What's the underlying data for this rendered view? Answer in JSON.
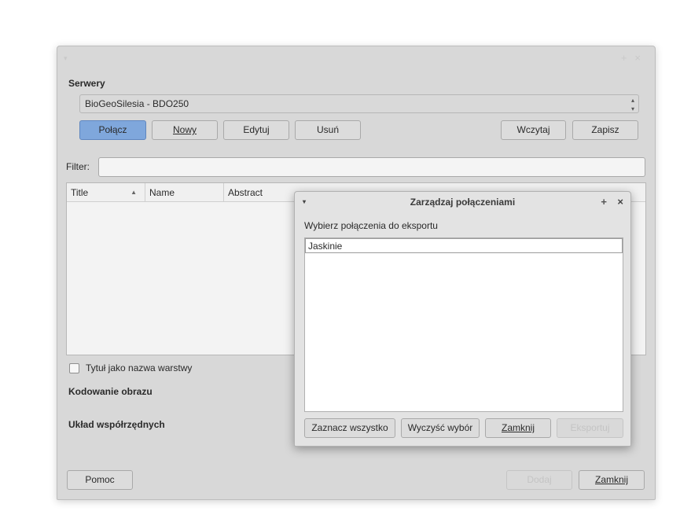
{
  "main": {
    "servers_label": "Serwery",
    "server_selected": "BioGeoSilesia - BDO250",
    "buttons": {
      "connect": "Połącz",
      "new": "Nowy",
      "edit": "Edytuj",
      "delete": "Usuń",
      "load": "Wczytaj",
      "save": "Zapisz"
    },
    "filter_label": "Filter:",
    "filter_value": "",
    "table_headers": [
      "Title",
      "Name",
      "Abstract"
    ],
    "title_as_layer_name": "Tytuł jako nazwa warstwy",
    "image_encoding_label": "Kodowanie obrazu",
    "crs_label": "Układ współrzędnych",
    "help_button": "Pomoc",
    "add_button": "Dodaj",
    "close_button": "Zamknij"
  },
  "manage": {
    "title": "Zarządzaj połączeniami",
    "select_label": "Wybierz połączenia do eksportu",
    "items": [
      "Jaskinie"
    ],
    "buttons": {
      "select_all": "Zaznacz wszystko",
      "clear_selection": "Wyczyść wybór",
      "close": "Zamknij",
      "export": "Eksportuj"
    }
  },
  "colors": {
    "primary_button": "#7fa7dc",
    "dialog_bg": "#d8d8d8"
  }
}
